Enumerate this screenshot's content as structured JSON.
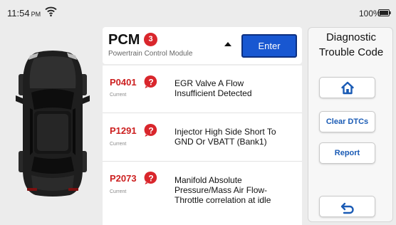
{
  "status_bar": {
    "time": "11:54",
    "ampm": "PM",
    "battery_percent": "100%",
    "battery_level": 1.0
  },
  "module": {
    "name": "PCM",
    "dtc_count": "3",
    "full_name": "Powertrain Control Module",
    "enter_label": "Enter"
  },
  "dtcs": [
    {
      "code": "P0401",
      "status": "Current",
      "description": [
        "EGR Valve A Flow",
        "Insufficient Detected"
      ]
    },
    {
      "code": "P1291",
      "status": "Current",
      "description": [
        "Injector High Side Short To",
        "GND Or VBATT (Bank1)"
      ]
    },
    {
      "code": "P2073",
      "status": "Current",
      "description": [
        "Manifold Absolute",
        "Pressure/Mass Air Flow-",
        "Throttle correlation at idle"
      ]
    }
  ],
  "side_panel": {
    "title_line1": "Diagnostic",
    "title_line2": "Trouble Code",
    "home_icon": "home-icon",
    "clear_label": "Clear DTCs",
    "report_label": "Report",
    "back_icon": "back-arrow-icon"
  },
  "colors": {
    "accent_blue": "#1857d1",
    "dtc_red": "#cc1f1f",
    "badge_red": "#d9262c",
    "button_text_blue": "#1a5bb5"
  }
}
